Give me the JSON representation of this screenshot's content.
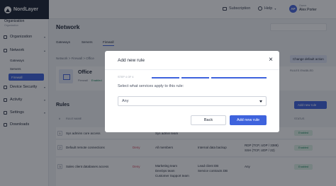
{
  "topbar": {
    "brand": "NordLayer",
    "subscription": "Subscription",
    "help": "Help",
    "user_initials": "AP",
    "user_role": "Owner",
    "user_name": "Alex Porter"
  },
  "sidebar": {
    "org_label": "Organization",
    "org_sub": "Organization",
    "items": [
      {
        "label": "Organization"
      },
      {
        "label": "Network"
      },
      {
        "label": "Device Security"
      },
      {
        "label": "Activity"
      },
      {
        "label": "Settings"
      },
      {
        "label": "Downloads"
      }
    ],
    "network_sub": [
      "Gateways",
      "Servers",
      "Firewall"
    ]
  },
  "main": {
    "title": "Network",
    "tabs": [
      "Gateways",
      "Servers",
      "Firewall"
    ],
    "breadcrumb": "Network > Firewall > Office",
    "office_name": "Office",
    "office_meta": "Firewall",
    "office_status": "Enabled",
    "change_default": "Change default action",
    "rules_enabled": "RULES ENABLED",
    "rules_title": "Rules",
    "add_rule": "Add new rule",
    "table_headers": [
      "#",
      "RULE NAME",
      "ACTION",
      "SOURCE",
      "SERVICE",
      "DESTINATION",
      "STATUS"
    ],
    "rows": [
      {
        "num": "1",
        "name": "Sys admins core access",
        "action": "",
        "source": "Sys admin team",
        "service": "",
        "destination": "",
        "status": "Enabled"
      },
      {
        "num": "2",
        "name": "Default remote connections",
        "action": "Deny",
        "source": "All members",
        "service": "Internal data backup",
        "destination": "RDP (TCP, UDP / 3389)\nSSH (TCP, UDP / 22)",
        "status": "Enabled"
      },
      {
        "num": "3",
        "name": "Sales client databases access",
        "action": "Deny",
        "source": "Marketing team\nDevOps team\nCustomer Support team",
        "service": "Lead client DB\nService contracts DB",
        "destination": "Any",
        "status": "Enabled"
      }
    ]
  },
  "modal": {
    "title": "Add new rule",
    "step": "STEP 4 OF 4",
    "question": "Select what services apply to this rule:",
    "select_value": "Any",
    "back": "Back",
    "add": "Add new rule",
    "progress_steps": 4,
    "progress_current": 4
  }
}
